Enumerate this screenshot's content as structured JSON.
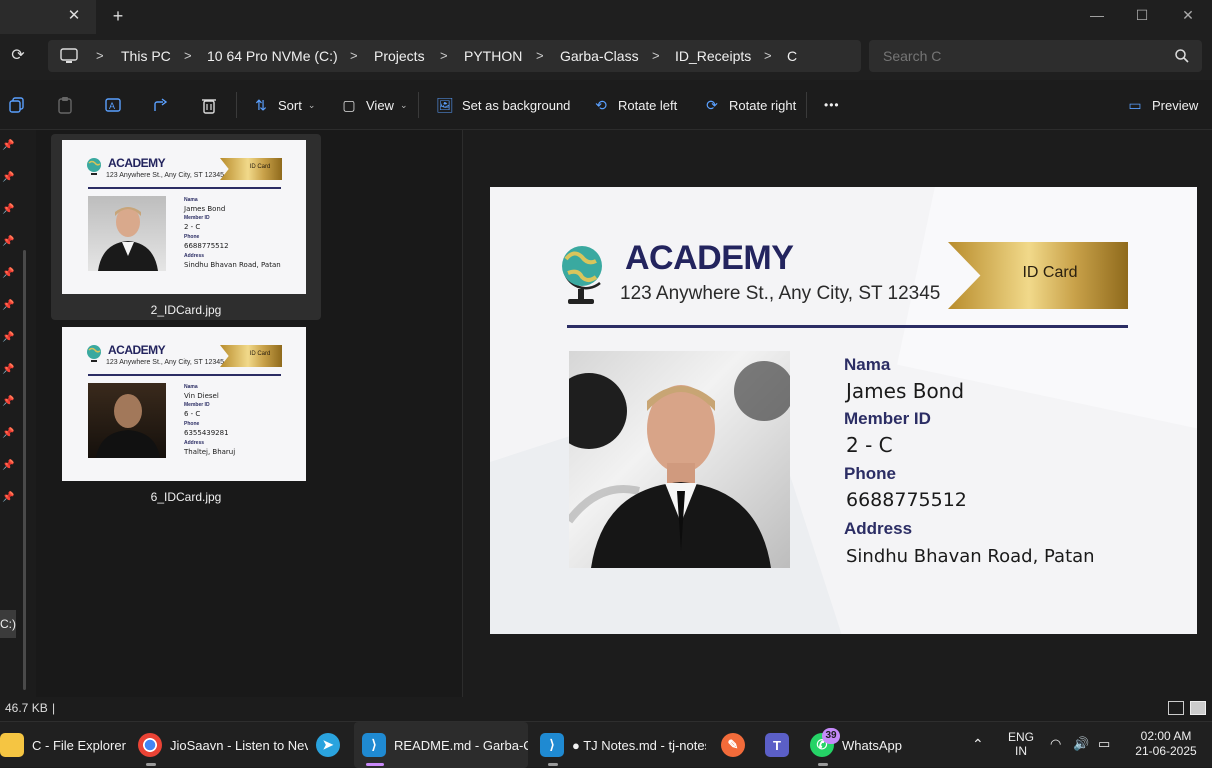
{
  "titlebar": {
    "tab_close": "✕",
    "new_tab": "+",
    "minimize": "—",
    "maximize": "☐",
    "close": "✕"
  },
  "address": {
    "crumbs": [
      "This PC",
      "10 64 Pro NVMe (C:)",
      "Projects",
      "PYTHON",
      "Garba-Class",
      "ID_Receipts",
      "C"
    ],
    "search_placeholder": "Search C"
  },
  "toolbar": {
    "sort": "Sort",
    "view": "View",
    "set_background": "Set as background",
    "rotate_left": "Rotate left",
    "rotate_right": "Rotate right",
    "more": "•••",
    "preview": "Preview"
  },
  "nav": {
    "drive_label": "C:)"
  },
  "files": [
    {
      "name": "2_IDCard.jpg",
      "selected": true,
      "member_name": "James Bond",
      "member_id": "2 - C",
      "phone": "6688775512",
      "address": "Sindhu Bhavan Road, Patan"
    },
    {
      "name": "6_IDCard.jpg",
      "selected": false,
      "member_name": "Vin Diesel",
      "member_id": "6 - C",
      "phone": "6355439281",
      "address": "Thaltej, Bharuj"
    }
  ],
  "card": {
    "brand": "ACADEMY",
    "address_line": "123 Anywhere St., Any City, ST 12345",
    "ribbon": "ID Card",
    "labels": {
      "name": "Nama",
      "member_id": "Member ID",
      "phone": "Phone",
      "address": "Address"
    },
    "values": {
      "name": "James Bond",
      "member_id": "2 - C",
      "phone": "6688775512",
      "address": "Sindhu Bhavan Road, Patan"
    }
  },
  "status": {
    "size": "46.7 KB",
    "cursor": "|"
  },
  "taskbar": {
    "items": [
      {
        "label": "C - File Explorer",
        "color": "#f5c542"
      },
      {
        "label": "JioSaavn - Listen to Nev",
        "color": "#4285f4"
      },
      {
        "label": "",
        "color": "#2aa3de"
      },
      {
        "label": "README.md - Garba-Cl",
        "color": "#1f8ad2"
      },
      {
        "label": "● TJ Notes.md - tj-notes",
        "color": "#1f8ad2"
      },
      {
        "label": "",
        "color": "#f26b3a"
      },
      {
        "label": "",
        "color": "#5b5fc7"
      },
      {
        "label": "WhatsApp",
        "color": "#25d366"
      }
    ],
    "whatsapp_badge": "39",
    "lang_top": "ENG",
    "lang_bottom": "IN",
    "time": "02:00 AM",
    "date": "21-06-2025"
  }
}
